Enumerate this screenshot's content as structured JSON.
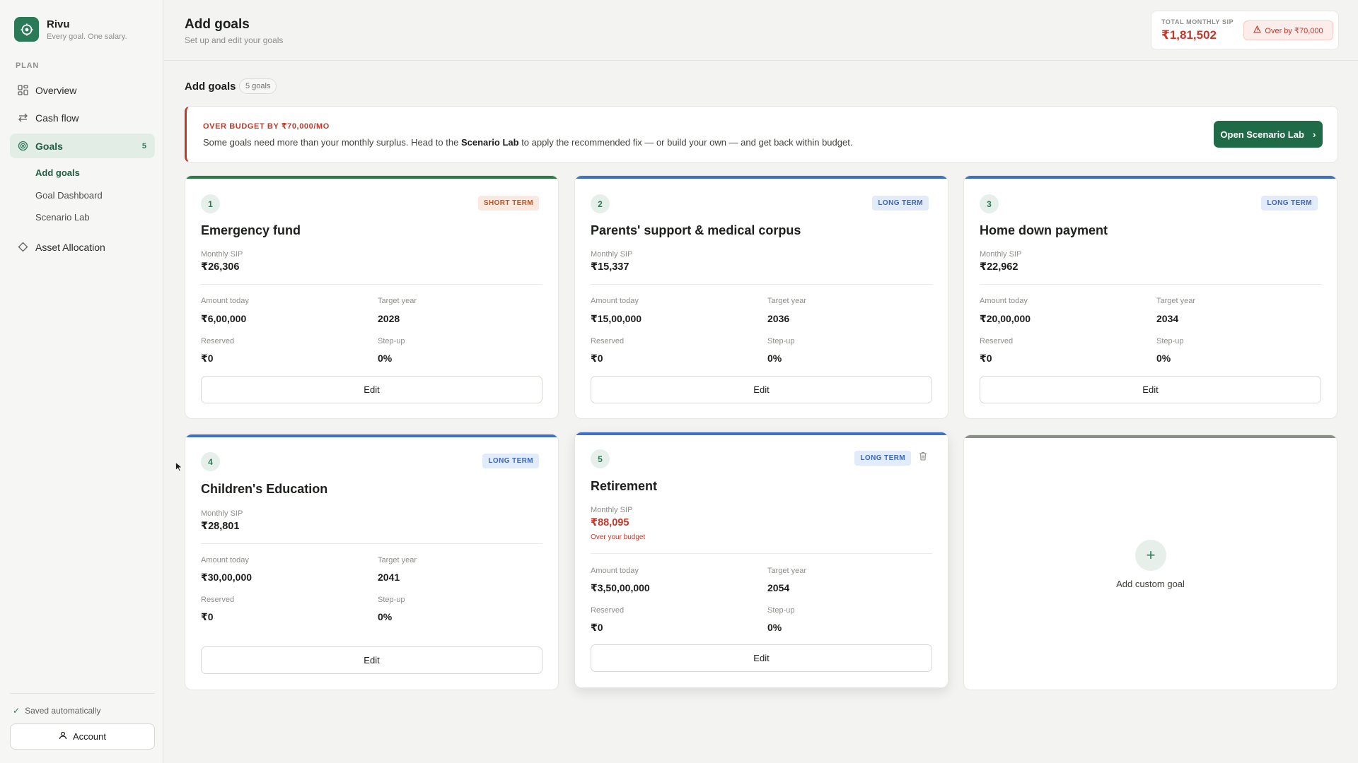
{
  "brand": {
    "name": "Rivu",
    "tagline": "Every goal. One salary."
  },
  "sidebar": {
    "section_label": "PLAN",
    "items": [
      {
        "label": "Overview",
        "icon": "grid-icon"
      },
      {
        "label": "Cash flow",
        "icon": "arrows-swap-icon"
      },
      {
        "label": "Goals",
        "icon": "target-icon",
        "count": "5"
      },
      {
        "label": "Asset Allocation",
        "icon": "diamond-icon"
      }
    ],
    "sub_items": [
      {
        "label": "Add goals"
      },
      {
        "label": "Goal Dashboard"
      },
      {
        "label": "Scenario Lab"
      }
    ],
    "saved_text": "Saved automatically",
    "account_label": "Account"
  },
  "header": {
    "title": "Add goals",
    "subtitle": "Set up and edit your goals",
    "sip_label": "TOTAL MONTHLY SIP",
    "sip_value": "₹1,81,502",
    "over_badge": "Over by ₹70,000"
  },
  "goals_section": {
    "heading": "Add goals",
    "count": "5 goals"
  },
  "banner": {
    "title": "OVER BUDGET BY ₹70,000/MO",
    "text_before": "Some goals need more than your monthly surplus. Head to the ",
    "text_bold": "Scenario Lab",
    "text_after": " to apply the recommended fix — or build your own — and get back within budget.",
    "button_label": "Open Scenario Lab"
  },
  "labels": {
    "monthly_sip": "Monthly SIP",
    "amount_today": "Amount today",
    "target_year": "Target year",
    "reserved": "Reserved",
    "step_up": "Step-up",
    "edit": "Edit",
    "over_budget": "Over your budget"
  },
  "goals": [
    {
      "number": "1",
      "term": "SHORT TERM",
      "name": "Emergency fund",
      "monthly_sip": "₹26,306",
      "amount_today": "₹6,00,000",
      "target_year": "2028",
      "reserved": "₹0",
      "step_up": "0%"
    },
    {
      "number": "2",
      "term": "LONG TERM",
      "name": "Parents' support & medical corpus",
      "monthly_sip": "₹15,337",
      "amount_today": "₹15,00,000",
      "target_year": "2036",
      "reserved": "₹0",
      "step_up": "0%"
    },
    {
      "number": "3",
      "term": "LONG TERM",
      "name": "Home down payment",
      "monthly_sip": "₹22,962",
      "amount_today": "₹20,00,000",
      "target_year": "2034",
      "reserved": "₹0",
      "step_up": "0%"
    },
    {
      "number": "4",
      "term": "LONG TERM",
      "name": "Children's Education",
      "monthly_sip": "₹28,801",
      "amount_today": "₹30,00,000",
      "target_year": "2041",
      "reserved": "₹0",
      "step_up": "0%"
    },
    {
      "number": "5",
      "term": "LONG TERM",
      "name": "Retirement",
      "monthly_sip": "₹88,095",
      "amount_today": "₹3,50,00,000",
      "target_year": "2054",
      "reserved": "₹0",
      "step_up": "0%"
    }
  ],
  "add_custom": {
    "label": "Add custom goal"
  },
  "colors": {
    "accent": "#2b7a57",
    "danger": "#c0392b",
    "short_bar": "#2d7a4a",
    "long_bar": "#3f70c9",
    "add_bar": "#8a8f86"
  }
}
